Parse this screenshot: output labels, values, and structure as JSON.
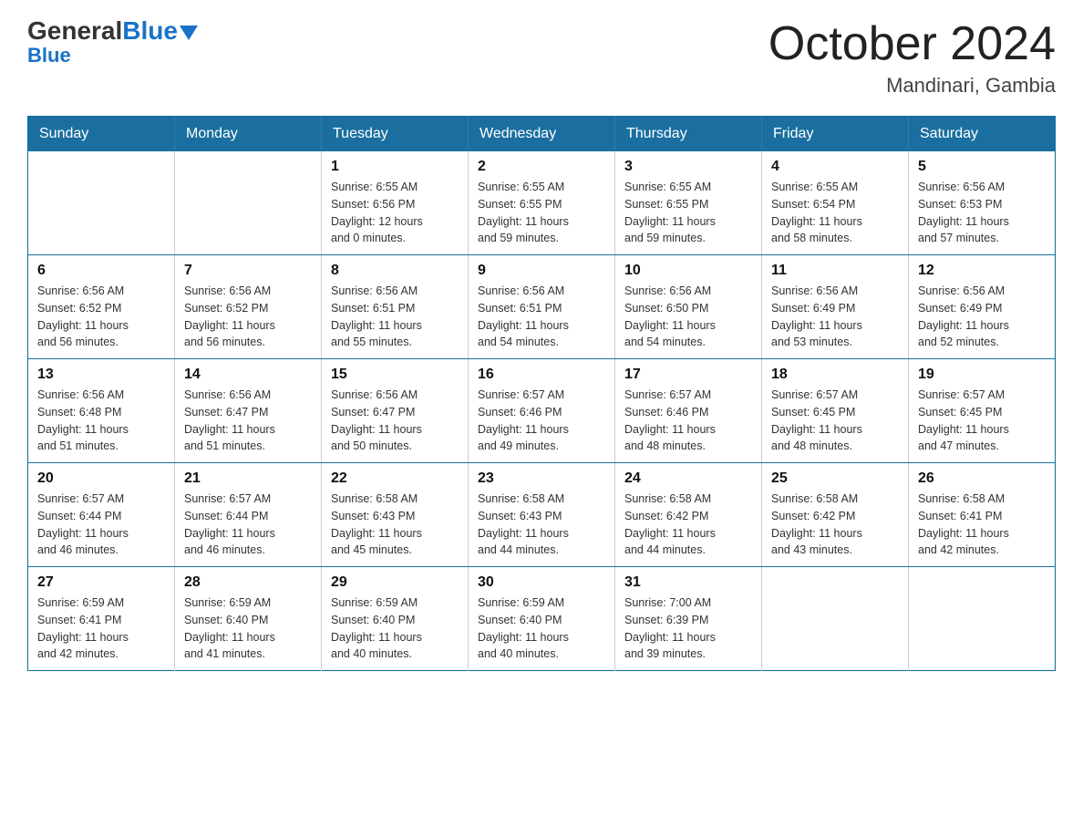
{
  "header": {
    "logo_general": "General",
    "logo_blue": "Blue",
    "title": "October 2024",
    "location": "Mandinari, Gambia"
  },
  "days_of_week": [
    "Sunday",
    "Monday",
    "Tuesday",
    "Wednesday",
    "Thursday",
    "Friday",
    "Saturday"
  ],
  "weeks": [
    [
      {
        "day": "",
        "info": ""
      },
      {
        "day": "",
        "info": ""
      },
      {
        "day": "1",
        "info": "Sunrise: 6:55 AM\nSunset: 6:56 PM\nDaylight: 12 hours\nand 0 minutes."
      },
      {
        "day": "2",
        "info": "Sunrise: 6:55 AM\nSunset: 6:55 PM\nDaylight: 11 hours\nand 59 minutes."
      },
      {
        "day": "3",
        "info": "Sunrise: 6:55 AM\nSunset: 6:55 PM\nDaylight: 11 hours\nand 59 minutes."
      },
      {
        "day": "4",
        "info": "Sunrise: 6:55 AM\nSunset: 6:54 PM\nDaylight: 11 hours\nand 58 minutes."
      },
      {
        "day": "5",
        "info": "Sunrise: 6:56 AM\nSunset: 6:53 PM\nDaylight: 11 hours\nand 57 minutes."
      }
    ],
    [
      {
        "day": "6",
        "info": "Sunrise: 6:56 AM\nSunset: 6:52 PM\nDaylight: 11 hours\nand 56 minutes."
      },
      {
        "day": "7",
        "info": "Sunrise: 6:56 AM\nSunset: 6:52 PM\nDaylight: 11 hours\nand 56 minutes."
      },
      {
        "day": "8",
        "info": "Sunrise: 6:56 AM\nSunset: 6:51 PM\nDaylight: 11 hours\nand 55 minutes."
      },
      {
        "day": "9",
        "info": "Sunrise: 6:56 AM\nSunset: 6:51 PM\nDaylight: 11 hours\nand 54 minutes."
      },
      {
        "day": "10",
        "info": "Sunrise: 6:56 AM\nSunset: 6:50 PM\nDaylight: 11 hours\nand 54 minutes."
      },
      {
        "day": "11",
        "info": "Sunrise: 6:56 AM\nSunset: 6:49 PM\nDaylight: 11 hours\nand 53 minutes."
      },
      {
        "day": "12",
        "info": "Sunrise: 6:56 AM\nSunset: 6:49 PM\nDaylight: 11 hours\nand 52 minutes."
      }
    ],
    [
      {
        "day": "13",
        "info": "Sunrise: 6:56 AM\nSunset: 6:48 PM\nDaylight: 11 hours\nand 51 minutes."
      },
      {
        "day": "14",
        "info": "Sunrise: 6:56 AM\nSunset: 6:47 PM\nDaylight: 11 hours\nand 51 minutes."
      },
      {
        "day": "15",
        "info": "Sunrise: 6:56 AM\nSunset: 6:47 PM\nDaylight: 11 hours\nand 50 minutes."
      },
      {
        "day": "16",
        "info": "Sunrise: 6:57 AM\nSunset: 6:46 PM\nDaylight: 11 hours\nand 49 minutes."
      },
      {
        "day": "17",
        "info": "Sunrise: 6:57 AM\nSunset: 6:46 PM\nDaylight: 11 hours\nand 48 minutes."
      },
      {
        "day": "18",
        "info": "Sunrise: 6:57 AM\nSunset: 6:45 PM\nDaylight: 11 hours\nand 48 minutes."
      },
      {
        "day": "19",
        "info": "Sunrise: 6:57 AM\nSunset: 6:45 PM\nDaylight: 11 hours\nand 47 minutes."
      }
    ],
    [
      {
        "day": "20",
        "info": "Sunrise: 6:57 AM\nSunset: 6:44 PM\nDaylight: 11 hours\nand 46 minutes."
      },
      {
        "day": "21",
        "info": "Sunrise: 6:57 AM\nSunset: 6:44 PM\nDaylight: 11 hours\nand 46 minutes."
      },
      {
        "day": "22",
        "info": "Sunrise: 6:58 AM\nSunset: 6:43 PM\nDaylight: 11 hours\nand 45 minutes."
      },
      {
        "day": "23",
        "info": "Sunrise: 6:58 AM\nSunset: 6:43 PM\nDaylight: 11 hours\nand 44 minutes."
      },
      {
        "day": "24",
        "info": "Sunrise: 6:58 AM\nSunset: 6:42 PM\nDaylight: 11 hours\nand 44 minutes."
      },
      {
        "day": "25",
        "info": "Sunrise: 6:58 AM\nSunset: 6:42 PM\nDaylight: 11 hours\nand 43 minutes."
      },
      {
        "day": "26",
        "info": "Sunrise: 6:58 AM\nSunset: 6:41 PM\nDaylight: 11 hours\nand 42 minutes."
      }
    ],
    [
      {
        "day": "27",
        "info": "Sunrise: 6:59 AM\nSunset: 6:41 PM\nDaylight: 11 hours\nand 42 minutes."
      },
      {
        "day": "28",
        "info": "Sunrise: 6:59 AM\nSunset: 6:40 PM\nDaylight: 11 hours\nand 41 minutes."
      },
      {
        "day": "29",
        "info": "Sunrise: 6:59 AM\nSunset: 6:40 PM\nDaylight: 11 hours\nand 40 minutes."
      },
      {
        "day": "30",
        "info": "Sunrise: 6:59 AM\nSunset: 6:40 PM\nDaylight: 11 hours\nand 40 minutes."
      },
      {
        "day": "31",
        "info": "Sunrise: 7:00 AM\nSunset: 6:39 PM\nDaylight: 11 hours\nand 39 minutes."
      },
      {
        "day": "",
        "info": ""
      },
      {
        "day": "",
        "info": ""
      }
    ]
  ]
}
